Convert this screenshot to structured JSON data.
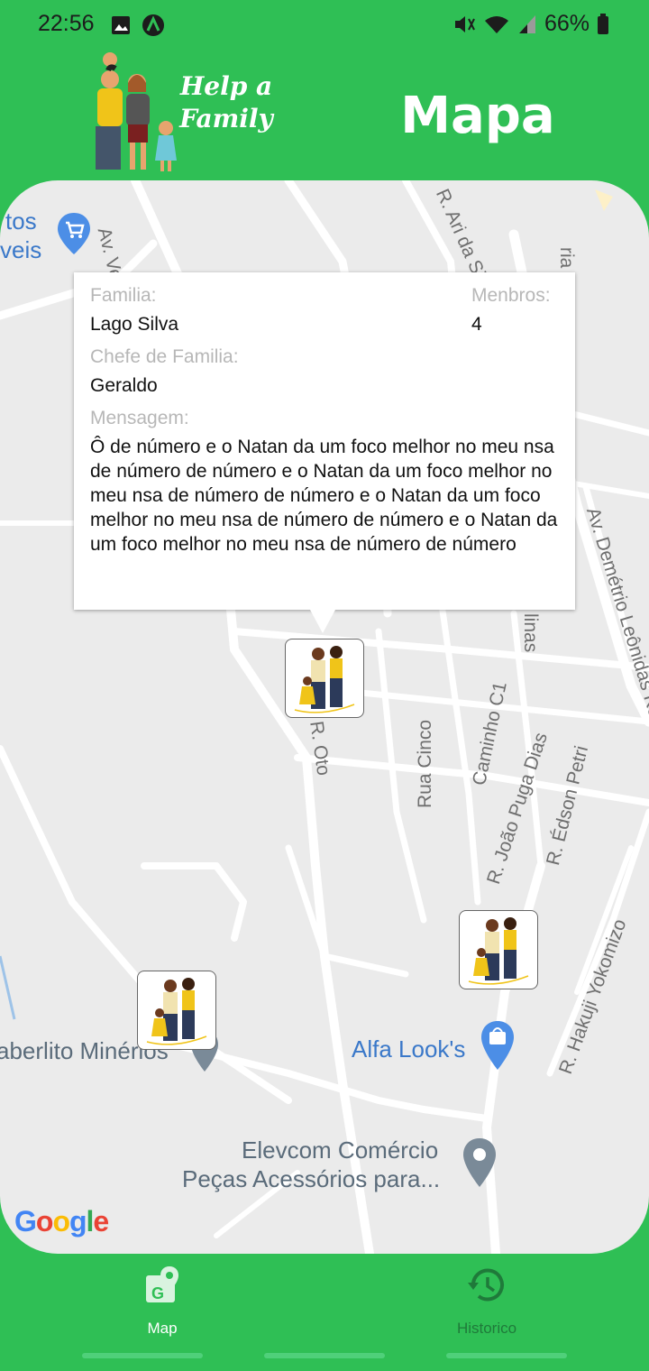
{
  "status_bar": {
    "time": "22:56",
    "battery": "66%"
  },
  "header": {
    "logo_line1": "Help a",
    "logo_line2": "Family",
    "page_title": "Mapa"
  },
  "info_window": {
    "family_label": "Familia:",
    "family_value": "Lago Silva",
    "members_label": "Menbros:",
    "members_value": "4",
    "head_label": "Chefe de Familia:",
    "head_value": "Geraldo",
    "message_label": "Mensagem:",
    "message_value": "Ô de número e o Natan da um foco melhor no meu nsa de número de número e o Natan da um foco melhor no meu nsa de número de número e o Natan da um foco melhor no meu nsa de número de número e o Natan da um foco melhor no meu nsa de número de número"
  },
  "map": {
    "labels": {
      "av_ver": "Av. Ver. Ni",
      "ari": "R. Ari da Si",
      "ria": "ria",
      "oto": "R. Oto",
      "rua_cinco": "Rua Cinco",
      "caminho": "Caminho C1",
      "joao": "R. João Puga Dias",
      "edson": "R. Édson Petri",
      "demetrio": "Av. Demétrio Leônidas Konides",
      "hakuji": "R. Hakuji Yokomizo",
      "linas": "linas"
    },
    "pois": {
      "top_left_1": "tos",
      "top_left_2": "veis",
      "alfa": "Alfa Look's",
      "laberlito": "aberlito Minérios",
      "elevcom_1": "Elevcom Comércio",
      "elevcom_2": "Peças Acessórios para..."
    },
    "attribution": "Google"
  },
  "bottom_nav": [
    {
      "label": "Map",
      "icon": "map-icon"
    },
    {
      "label": "Historico",
      "icon": "history-icon"
    }
  ]
}
